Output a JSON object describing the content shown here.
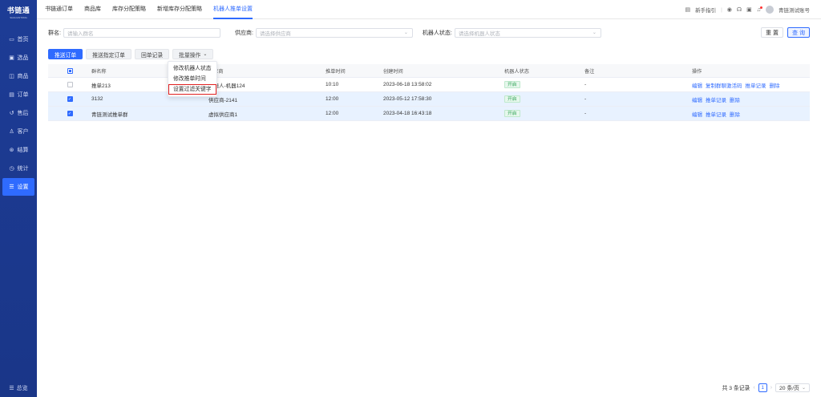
{
  "sidebar": {
    "logo_title": "书链通",
    "logo_sub": "SHULIANTONG",
    "items": [
      {
        "label": "首页",
        "icon": "monitor-icon",
        "glyph": "▭"
      },
      {
        "label": "选品",
        "icon": "select-icon",
        "glyph": "▣"
      },
      {
        "label": "商品",
        "icon": "goods-icon",
        "glyph": "◫"
      },
      {
        "label": "订单",
        "icon": "order-icon",
        "glyph": "▤"
      },
      {
        "label": "售后",
        "icon": "after-sale-icon",
        "glyph": "↺"
      },
      {
        "label": "客户",
        "icon": "customer-icon",
        "glyph": "♙"
      },
      {
        "label": "结算",
        "icon": "settlement-icon",
        "glyph": "⊛"
      },
      {
        "label": "统计",
        "icon": "stats-icon",
        "glyph": "◷"
      },
      {
        "label": "设置",
        "icon": "settings-icon",
        "glyph": "☰"
      }
    ],
    "active_index": 8,
    "bottom_label": "总览",
    "bottom_glyph": "☰"
  },
  "topnav": {
    "tabs": [
      "书链通订单",
      "商品库",
      "库存分配策略",
      "新增库存分配策略",
      "机器人推单设置"
    ],
    "active_index": 4,
    "guide_label": "新手指引",
    "user_name": "青链测试账号"
  },
  "filters": {
    "group_label": "群名:",
    "group_placeholder": "请输入群名",
    "supplier_label": "供应商:",
    "supplier_placeholder": "请选择供应商",
    "status_label": "机器人状态:",
    "status_placeholder": "请选择机器人状态",
    "reset_label": "重 置",
    "query_label": "查 询"
  },
  "toolbar": {
    "push_order": "推送订单",
    "push_specified": "推送指定订单",
    "reply_records": "回单记录",
    "batch_ops": "批量操作"
  },
  "dropdown": {
    "items": [
      "修改机器人状态",
      "修改推单时间",
      "设置过滤关键字"
    ],
    "highlight_index": 2
  },
  "table": {
    "headers": [
      "群名称",
      "供应商",
      "推单时间",
      "创建时间",
      "机器人状态",
      "备注",
      "操作"
    ],
    "rows": [
      {
        "name": "推单213",
        "supplier": "机器人-机器124",
        "time": "10:10",
        "created": "2023-06-18 13:58:02",
        "status": "开启",
        "remark": "-",
        "ops": [
          "编辑",
          "复制群聊激活码",
          "推单记录",
          "删除"
        ],
        "selected": false
      },
      {
        "name": "3132",
        "supplier": "供应商-2141",
        "time": "12:00",
        "created": "2023-05-12 17:58:30",
        "status": "开启",
        "remark": "-",
        "ops": [
          "编辑",
          "推单记录",
          "删除"
        ],
        "selected": true
      },
      {
        "name": "青链测试推单群",
        "supplier": "虚拟供应商1",
        "time": "12:00",
        "created": "2023-04-18 16:43:18",
        "status": "开启",
        "remark": "-",
        "ops": [
          "编辑",
          "推单记录",
          "删除"
        ],
        "selected": true
      }
    ]
  },
  "pager": {
    "total_text": "共 3 条记录",
    "current_page": "1",
    "page_size": "20 条/页"
  },
  "colors": {
    "primary": "#2f6bff",
    "sidebar": "#1d3c96",
    "status_green": "#2fa456",
    "highlight_red": "#e02020"
  }
}
